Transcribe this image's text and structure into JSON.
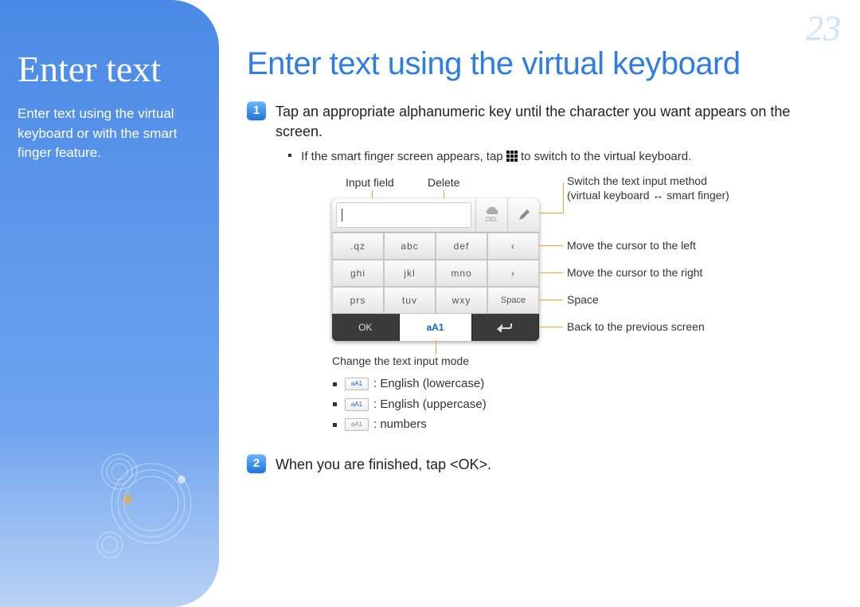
{
  "page_number": "23",
  "sidebar": {
    "title": "Enter text",
    "description": "Enter text using the virtual keyboard or with the smart finger feature."
  },
  "main": {
    "title": "Enter text using the virtual keyboard",
    "step1_badge": "1",
    "step1_text": "Tap an appropriate alphanumeric key until the character you want appears on the screen.",
    "step1_sub_before": "If the smart finger screen appears, tap ",
    "step1_sub_after": " to switch to the virtual keyboard.",
    "step2_badge": "2",
    "step2_text": "When you are finished, tap <OK>."
  },
  "annot": {
    "input_field": "Input field",
    "delete": "Delete",
    "switch1": "Switch the text input method",
    "switch2": "(virtual keyboard ↔ smart finger)",
    "move_left": "Move the cursor to the left",
    "move_right": "Move the cursor to the right",
    "space": "Space",
    "back": "Back to the previous screen",
    "change_mode": "Change the text input mode"
  },
  "keys": {
    "k1": ".qz",
    "k2": "abc",
    "k3": "def",
    "k4": "‹",
    "k5": "ghi",
    "k6": "jkl",
    "k7": "mno",
    "k8": "›",
    "k9": "prs",
    "k10": "tuv",
    "k11": "wxy",
    "k12": "Space",
    "ok": "OK",
    "mode": "aA1",
    "del": "DEL"
  },
  "modes": {
    "m1": ": English (lowercase)",
    "m2": ": English (uppercase)",
    "m3": ": numbers",
    "chip1": "aA1",
    "chip2": "aA1",
    "chip3": "aA1"
  }
}
